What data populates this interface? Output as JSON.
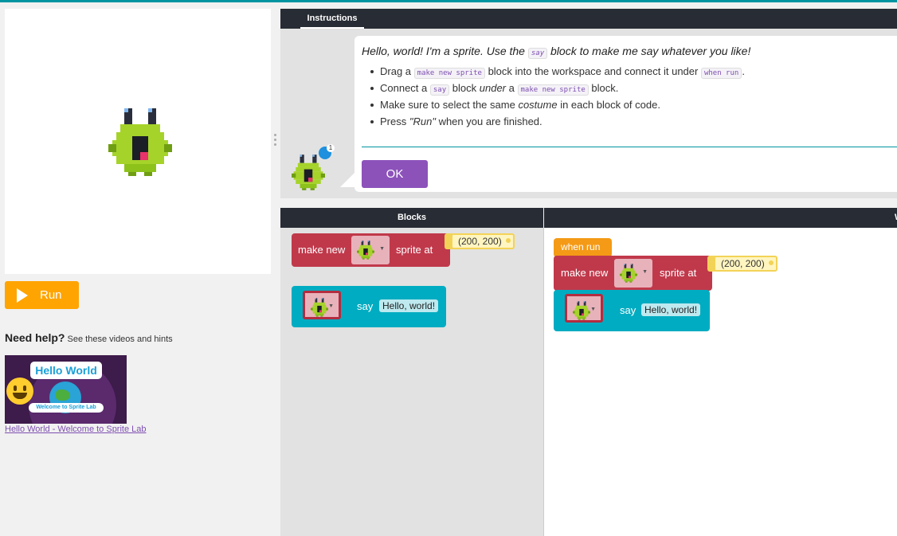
{
  "stage": {
    "sprite_icon": "alien-sprite-icon"
  },
  "run_button": {
    "label": "Run",
    "icon": "play-icon"
  },
  "help": {
    "heading": "Need help?",
    "subtext": "See these videos and hints",
    "video": {
      "thumb_title": "Hello World",
      "thumb_subtitle": "Welcome to Sprite Lab",
      "link_text": "Hello World - Welcome to Sprite Lab"
    }
  },
  "instructions": {
    "tab_label": "Instructions",
    "title_prefix": "Hello, world! I'm a sprite. Use the",
    "title_code": "say",
    "title_suffix": "block to make me say whatever you like!",
    "steps": [
      {
        "a": "Drag a",
        "code1": "make new sprite",
        "b": "block into the workspace and connect it under",
        "code2": "when run",
        "c": "."
      },
      {
        "a": "Connect a",
        "code1": "say",
        "b": "block",
        "em": "under",
        "c": "a",
        "code2": "make new sprite",
        "d": "block."
      },
      {
        "a": "Make sure to select the same",
        "em": "costume",
        "b": "in each block of code."
      },
      {
        "a": "Press",
        "em": "\"Run\"",
        "b": "when you are finished."
      }
    ],
    "ok_label": "OK",
    "avatar_badge_count": "1"
  },
  "blocks_panel": {
    "header": "Blocks",
    "make_new_block": {
      "label": "make new",
      "suffix": "sprite at",
      "location": "(200, 200)"
    },
    "say_block": {
      "label": "say",
      "text": "Hello, world!"
    }
  },
  "workspace": {
    "header_fragment": "W",
    "when_run_label": "when run",
    "make_new_block": {
      "label": "make new",
      "suffix": "sprite at",
      "location": "(200, 200)"
    },
    "say_block": {
      "label": "say",
      "text": "Hello, world!"
    }
  },
  "colors": {
    "accent_teal": "#0094a1",
    "run_orange": "#ffa400",
    "ok_purple": "#8c52ba",
    "block_red": "#c0394b",
    "block_teal": "#00acc1",
    "event_orange": "#f49a16"
  }
}
